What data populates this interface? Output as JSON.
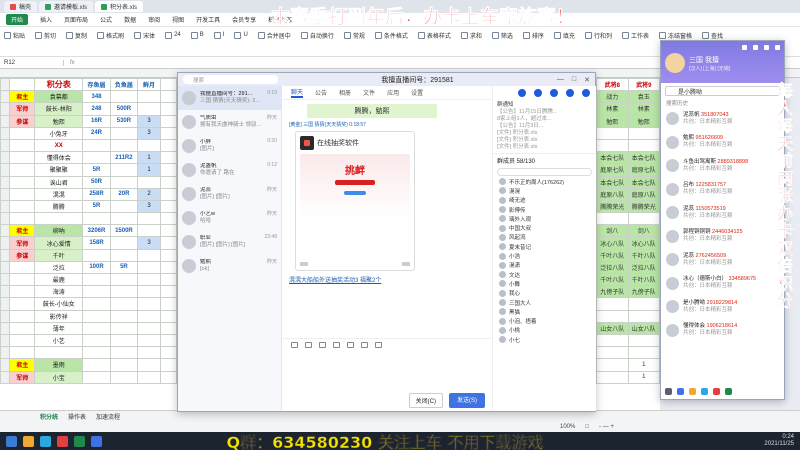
{
  "app": {
    "tabs": [
      {
        "label": "稿壳",
        "color": "#e54b4b"
      },
      {
        "label": "邀请模板.xls",
        "color": "#2e9e5b"
      },
      {
        "label": "积分表.xls",
        "color": "#2e9e5b"
      }
    ],
    "ribbon_tabs": [
      "开始",
      "插入",
      "页面布局",
      "公式",
      "数据",
      "审阅",
      "视图",
      "开发工具",
      "会员专享",
      "稻壳资源"
    ],
    "ribbon_tools": [
      "粘贴",
      "剪切",
      "复制",
      "格式刷",
      "宋体",
      "24",
      "B",
      "I",
      "U",
      "合并居中",
      "自动换行",
      "常规",
      "条件格式",
      "表格样式",
      "求和",
      "筛选",
      "排序",
      "填充",
      "行和列",
      "工作表",
      "冻结窗格",
      "查找"
    ],
    "cell_ref": "R12",
    "fx": "fx"
  },
  "sheet": {
    "title": "积分表",
    "headers": [
      "",
      "",
      "存鱼届",
      "负鱼届",
      "鲜月"
    ],
    "rows": [
      {
        "a": "君主",
        "b": "袁幕都",
        "c": "348",
        "d": "",
        "e": "",
        "f": "",
        "style": "gold"
      },
      {
        "a": "军师",
        "b": "鼓长-林阳",
        "c": "248",
        "d": "500R",
        "e": "",
        "f": "",
        "style": "lgrn"
      },
      {
        "a": "参谋",
        "b": "勉熙",
        "c": "16R",
        "d": "530R",
        "e": "3",
        "f": "",
        "style": "lgrn"
      },
      {
        "a": "",
        "b": "小兔牙",
        "c": "24R",
        "d": "",
        "e": "3",
        "f": "",
        "style": ""
      },
      {
        "a": "",
        "b": "XX",
        "c": "",
        "d": "",
        "e": "",
        "f": "",
        "style": "red"
      },
      {
        "a": "",
        "b": "懂得体会",
        "c": "",
        "d": "211R2",
        "e": "1",
        "f": "",
        "style": ""
      },
      {
        "a": "",
        "b": "聚聚聚",
        "c": "5R",
        "d": "",
        "e": "1",
        "f": "",
        "style": ""
      },
      {
        "a": "",
        "b": "诶山君",
        "c": "50R",
        "d": "",
        "e": "",
        "f": "",
        "style": ""
      },
      {
        "a": "",
        "b": "滉滉",
        "c": "258R",
        "d": "20R",
        "e": "2",
        "f": "",
        "style": ""
      },
      {
        "a": "",
        "b": "腾腾",
        "c": "5R",
        "d": "",
        "e": "3",
        "f": "",
        "style": ""
      },
      {
        "a": "",
        "b": "",
        "c": "",
        "d": "",
        "e": "",
        "f": "",
        "style": ""
      },
      {
        "a": "君主",
        "b": "柳吶",
        "c": "3206R",
        "d": "1500R",
        "e": "",
        "f": "",
        "style": "gold"
      },
      {
        "a": "军师",
        "b": "冰心爱情",
        "c": "158R",
        "d": "",
        "e": "3",
        "f": "",
        "style": "lgrn"
      },
      {
        "a": "参谋",
        "b": "千叶",
        "c": "",
        "d": "",
        "e": "",
        "f": "",
        "style": "lgrn"
      },
      {
        "a": "",
        "b": "泛拉",
        "c": "100R",
        "d": "5R",
        "e": "",
        "f": "",
        "style": ""
      },
      {
        "a": "",
        "b": "最鹿",
        "c": "",
        "d": "",
        "e": "",
        "f": "",
        "style": ""
      },
      {
        "a": "",
        "b": "海涛",
        "c": "",
        "d": "",
        "e": "",
        "f": "",
        "style": ""
      },
      {
        "a": "",
        "b": "鼓长-小仙女",
        "c": "",
        "d": "",
        "e": "",
        "f": "",
        "style": ""
      },
      {
        "a": "",
        "b": "影传祥",
        "c": "",
        "d": "",
        "e": "",
        "f": "",
        "style": ""
      },
      {
        "a": "",
        "b": "薄年",
        "c": "",
        "d": "",
        "e": "",
        "f": "",
        "style": ""
      },
      {
        "a": "",
        "b": "小艺",
        "c": "",
        "d": "",
        "e": "",
        "f": "",
        "style": ""
      },
      {
        "a": "",
        "b": "",
        "c": "",
        "d": "",
        "e": "",
        "f": "",
        "style": ""
      },
      {
        "a": "君主",
        "b": "墨雨",
        "c": "",
        "d": "",
        "e": "",
        "f": "",
        "style": "gold"
      },
      {
        "a": "军师",
        "b": "小宝",
        "c": "",
        "d": "",
        "e": "",
        "f": "",
        "style": "lgrn"
      }
    ],
    "right_header": [
      "武将8",
      "武将9"
    ],
    "right_rows": [
      [
        "战力",
        "袁玉"
      ],
      [
        "林素",
        "林素"
      ],
      [
        "勉熙",
        "勉熙"
      ],
      [
        "",
        ""
      ],
      [
        "",
        ""
      ],
      [
        "本会七队",
        "本会七队"
      ],
      [
        "庭原七队",
        "庭原七队"
      ],
      [
        "本会七队",
        "本会七队"
      ],
      [
        "庭原八队",
        "庭原八队"
      ],
      [
        "腾腾荣光",
        "腾腾荣光"
      ],
      [
        "",
        ""
      ],
      [
        "剑八",
        "剑八"
      ],
      [
        "冰心八队",
        "冰心八队"
      ],
      [
        "千叶八队",
        "千叶八队"
      ],
      [
        "泛拉八队",
        "泛拉八队"
      ],
      [
        "千叶八队",
        "千叶八队"
      ],
      [
        "九傍子队",
        "九傍子队"
      ],
      [
        "",
        ""
      ],
      [
        "",
        ""
      ],
      [
        "山女八队",
        "山女八队"
      ],
      [
        "",
        ""
      ],
      [
        "",
        ""
      ],
      [
        "",
        "1"
      ],
      [
        "",
        "1"
      ]
    ],
    "sheet_tabs": [
      "积分统",
      "操作表",
      "加速流程"
    ],
    "status": [
      "100%",
      "□",
      "- — +"
    ]
  },
  "chat": {
    "search_placeholder": "搜索",
    "title": "我擅直播间号：291581",
    "window_controls": [
      "—",
      "□",
      "✕"
    ],
    "conversations": [
      {
        "name": "我擅直播间号：291...",
        "msg": "三国 猜猜(天天猜奖): 2...",
        "time": "0:19"
      },
      {
        "name": "气质虫",
        "msg": "拥有我天虞神骑士 领驭...",
        "time": "昨天"
      },
      {
        "name": "小胖",
        "msg": "[图片]",
        "time": "0:20"
      },
      {
        "name": "泥盏帆",
        "msg": "你邀请了 路在",
        "time": "0:12"
      },
      {
        "name": "泥蕊",
        "msg": "[图片] [图片]",
        "time": "昨天"
      },
      {
        "name": "小艺w",
        "msg": "哈哈",
        "time": "昨天"
      },
      {
        "name": "职业",
        "msg": "[图片] [图片] [图片]",
        "time": "23:48"
      },
      {
        "name": "勉熙",
        "msg": "[ok]",
        "time": "昨天"
      }
    ],
    "main_tabs": [
      "聊天",
      "公告",
      "相册",
      "文件",
      "应用",
      "设置"
    ],
    "bubble1": "腾腾，勉熙",
    "meta1": "[黄金] 三国 猜猜(天天猜奖) 0:18:57",
    "card_title": "在线抽奖软件",
    "card_banner": "挑衅",
    "link": "滉滉大船船外送抽奖活动3 福聚2个",
    "close_btn": "关闭(C)",
    "send_btn": "发送(S)",
    "right": {
      "notice_title": "群通知",
      "notice1": "【公告】11月15日腾腾...",
      "notice2": "8家上组1人，超过本...",
      "notice3": "【公告】11月3日...",
      "file1": "[文件] 积分表.xls",
      "file2": "[文件] 积分表.xls",
      "file3": "[文件] 积分表.xls",
      "member_header": "群成员 58/130",
      "members": [
        "不乐正的周人(176262)",
        "滉滉",
        "绮无迹",
        "影傅传",
        "璃外入观",
        "中国大叔",
        "风起流",
        "夏末昔记",
        "小浩",
        "滉潇",
        "文达",
        "小舞",
        "我心",
        "三国大人",
        "黑猫",
        "小泡、捂着",
        "小桃",
        "小七"
      ]
    }
  },
  "qq": {
    "name": "三国 我擅",
    "sub": "[汉人] [上海] [无锡]",
    "search": "是小腾呦",
    "label": "搜索历史",
    "contacts": [
      {
        "name": "泥蕊帆",
        "num": "351807043",
        "msg": "共创：日本精彩互赖"
      },
      {
        "name": "勉熙",
        "num": "951626609",
        "msg": "共创：日本精彩互赖"
      },
      {
        "name": "斗鱼出驾寓斯",
        "num": "2889318898",
        "msg": "共创：日本精彩互赖"
      },
      {
        "name": "吕布",
        "num": "1225831757",
        "msg": "共创：日本精彩互赖"
      },
      {
        "name": "泥蕊",
        "num": "1150573519",
        "msg": "共创：日本精彩互赖"
      },
      {
        "name": "郭程铜铜铜",
        "num": "2446034125",
        "msg": "共创：日本精彩互赖"
      },
      {
        "name": "泥蕊",
        "num": "2762456509",
        "msg": "共创：日本精彩互赖"
      },
      {
        "name": "冰心（德斯小白）",
        "num": "334589675",
        "msg": "共创：日本精彩互赖"
      },
      {
        "name": "是小腾呦",
        "num": "2918229814",
        "msg": "共创：日本精彩互赖"
      },
      {
        "name": "懂得体会",
        "num": "1906218614",
        "msg": "共创：日本精彩互赖"
      }
    ]
  },
  "overlays": {
    "top": "本赛季打到年后，办卡上车家族赛！",
    "bottom": "Q群：634580230 关注上车 不用下载游戏",
    "side": "每人每天前两张办卡双倍积分"
  },
  "tray": {
    "time": "0:24",
    "date": "2021/11/25"
  }
}
